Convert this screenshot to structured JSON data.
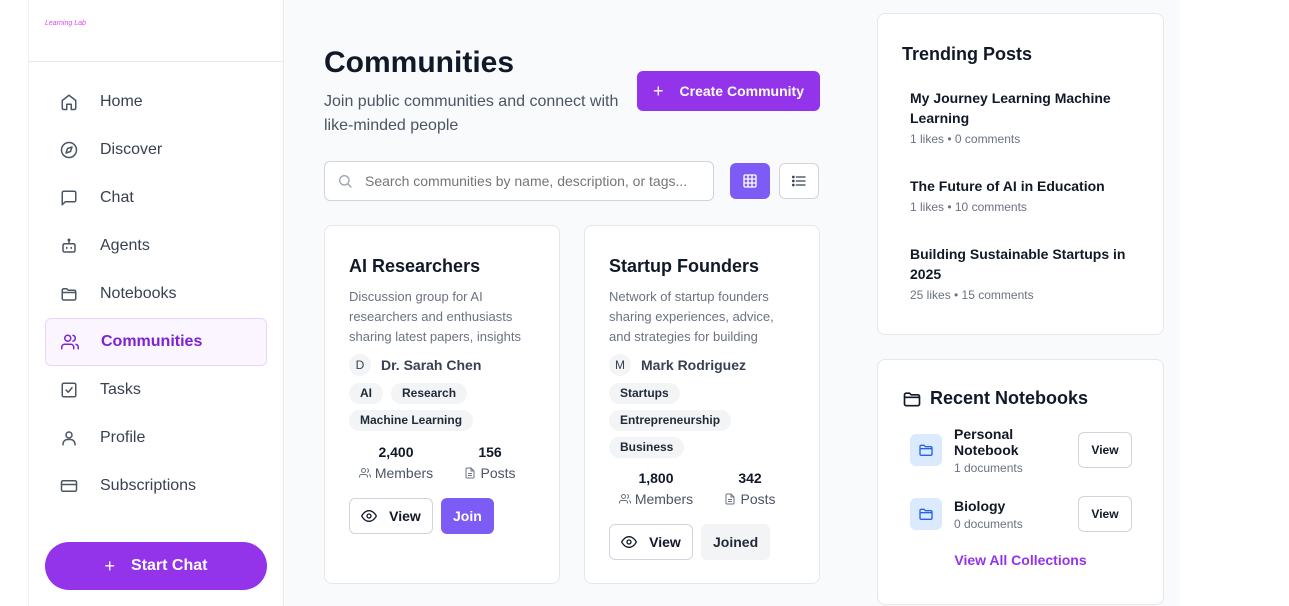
{
  "sidebar": {
    "logo_text": "Learning Lab",
    "items": [
      {
        "label": "Home",
        "icon": "home-icon"
      },
      {
        "label": "Discover",
        "icon": "compass-icon"
      },
      {
        "label": "Chat",
        "icon": "chat-icon"
      },
      {
        "label": "Agents",
        "icon": "bot-icon"
      },
      {
        "label": "Notebooks",
        "icon": "folder-icon"
      },
      {
        "label": "Communities",
        "icon": "users-icon",
        "active": true
      },
      {
        "label": "Tasks",
        "icon": "checkbox-icon"
      },
      {
        "label": "Profile",
        "icon": "user-icon"
      },
      {
        "label": "Subscriptions",
        "icon": "credit-card-icon"
      }
    ],
    "start_chat_label": "Start Chat"
  },
  "header": {
    "title": "Communities",
    "subtitle": "Join public communities and connect with like-minded people",
    "create_label": "Create Community"
  },
  "search": {
    "placeholder": "Search communities by name, description, or tags..."
  },
  "communities": [
    {
      "name": "AI Researchers",
      "description": "Discussion group for AI researchers and enthusiasts sharing latest papers, insights and discussions",
      "owner_initial": "D",
      "owner": "Dr. Sarah Chen",
      "tags": [
        "AI",
        "Research",
        "Machine Learning"
      ],
      "members": "2,400",
      "members_label": "Members",
      "posts": "156",
      "posts_label": "Posts",
      "view_label": "View",
      "action_label": "Join"
    },
    {
      "name": "Startup Founders",
      "description": "Network of startup founders sharing experiences, advice, and strategies for building successful companies",
      "owner_initial": "M",
      "owner": "Mark Rodriguez",
      "tags": [
        "Startups",
        "Entrepreneurship",
        "Business"
      ],
      "members": "1,800",
      "members_label": "Members",
      "posts": "342",
      "posts_label": "Posts",
      "view_label": "View",
      "action_label": "Joined"
    }
  ],
  "trending": {
    "title": "Trending Posts",
    "posts": [
      {
        "title": "My Journey Learning Machine Learning",
        "meta": "1 likes • 0 comments"
      },
      {
        "title": "The Future of AI in Education",
        "meta": "1 likes • 10 comments"
      },
      {
        "title": "Building Sustainable Startups in 2025",
        "meta": "25 likes • 15 comments"
      }
    ]
  },
  "notebooks": {
    "title": "Recent Notebooks",
    "items": [
      {
        "name": "Personal Notebook",
        "count": "1 documents",
        "view_label": "View"
      },
      {
        "name": "Biology",
        "count": "0 documents",
        "view_label": "View"
      }
    ],
    "view_all_label": "View All Collections"
  },
  "colors": {
    "accent": "#9333ea",
    "accent_secondary": "#7c5cf5",
    "active_nav_bg": "#faf5ff",
    "notebook_icon_bg": "#dbeafe"
  }
}
